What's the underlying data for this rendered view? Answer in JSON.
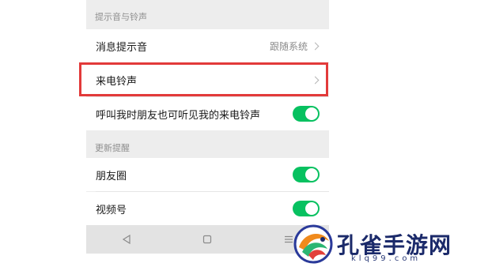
{
  "sections": {
    "sound": {
      "header": "提示音与铃声",
      "message_sound": {
        "label": "消息提示音",
        "value": "跟随系统"
      },
      "ringtone": {
        "label": "来电铃声"
      },
      "friends_hear": {
        "label": "呼叫我时朋友也可听见我的来电铃声",
        "enabled": true
      }
    },
    "updates": {
      "header": "更新提醒",
      "moments": {
        "label": "朋友圈",
        "enabled": true
      },
      "channels": {
        "label": "视频号",
        "enabled": true
      }
    }
  },
  "navbar": {
    "back": "◁",
    "home": "▢",
    "menu": "☰"
  },
  "watermark": {
    "title": "孔雀手游网",
    "url": "klq99.com"
  },
  "colors": {
    "toggle_on": "#07c160",
    "highlight": "#e23a3a",
    "background": "#ededed"
  }
}
